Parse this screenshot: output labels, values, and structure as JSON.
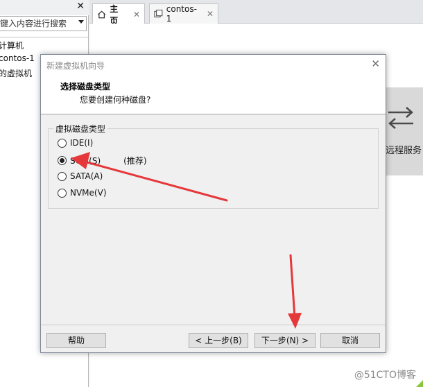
{
  "library": {
    "search_placeholder": "键入内容进行搜索",
    "items": [
      "计算机",
      "contos-1",
      "的虚拟机"
    ]
  },
  "tabs": [
    {
      "label": "主页",
      "active": true,
      "icon": "home-icon"
    },
    {
      "label": "contos-1",
      "active": false,
      "icon": "vm-tab-icon"
    }
  ],
  "background": {
    "remote_label": "远程服务"
  },
  "dialog": {
    "title": "新建虚拟机向导",
    "heading": "选择磁盘类型",
    "subheading": "您要创建何种磁盘?",
    "group_label": "虚拟磁盘类型",
    "options": [
      {
        "label": "IDE(I)",
        "checked": false,
        "hint": ""
      },
      {
        "label": "SCSI(S)",
        "checked": true,
        "hint": "(推荐)"
      },
      {
        "label": "SATA(A)",
        "checked": false,
        "hint": ""
      },
      {
        "label": "NVMe(V)",
        "checked": false,
        "hint": ""
      }
    ],
    "buttons": {
      "help": "帮助",
      "back": "< 上一步(B)",
      "next": "下一步(N) >",
      "cancel": "取消"
    }
  },
  "watermark": "@51CTO博客",
  "colors": {
    "annotation_red": "#e5383b",
    "dialog_bg": "#f0f0f0",
    "remote_card": "#d9d9d9"
  }
}
